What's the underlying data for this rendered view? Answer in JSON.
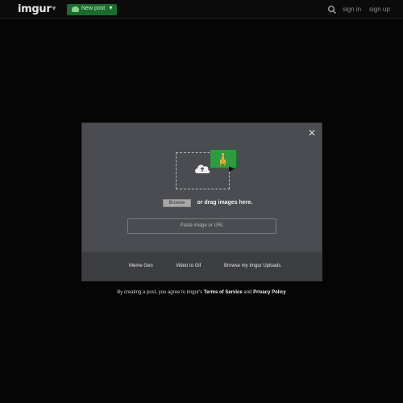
{
  "header": {
    "logo": "imgur",
    "new_post_label": "New post",
    "sign_in": "sign in",
    "sign_up": "sign up"
  },
  "upload_modal": {
    "browse_button": "Browse",
    "drag_text": "or drag images here.",
    "paste_placeholder": "Paste image or URL",
    "footer_links": [
      "Meme Gen",
      "Video to Gif",
      "Browse my Imgur Uploads"
    ]
  },
  "legal": {
    "prefix": "By creating a post, you agree to Imgur's",
    "terms": "Terms of Service",
    "and": "and",
    "privacy": "Privacy Policy"
  },
  "colors": {
    "background": "#050505",
    "modal": "#4a4c51",
    "accent_green": "#1b6b2e"
  }
}
